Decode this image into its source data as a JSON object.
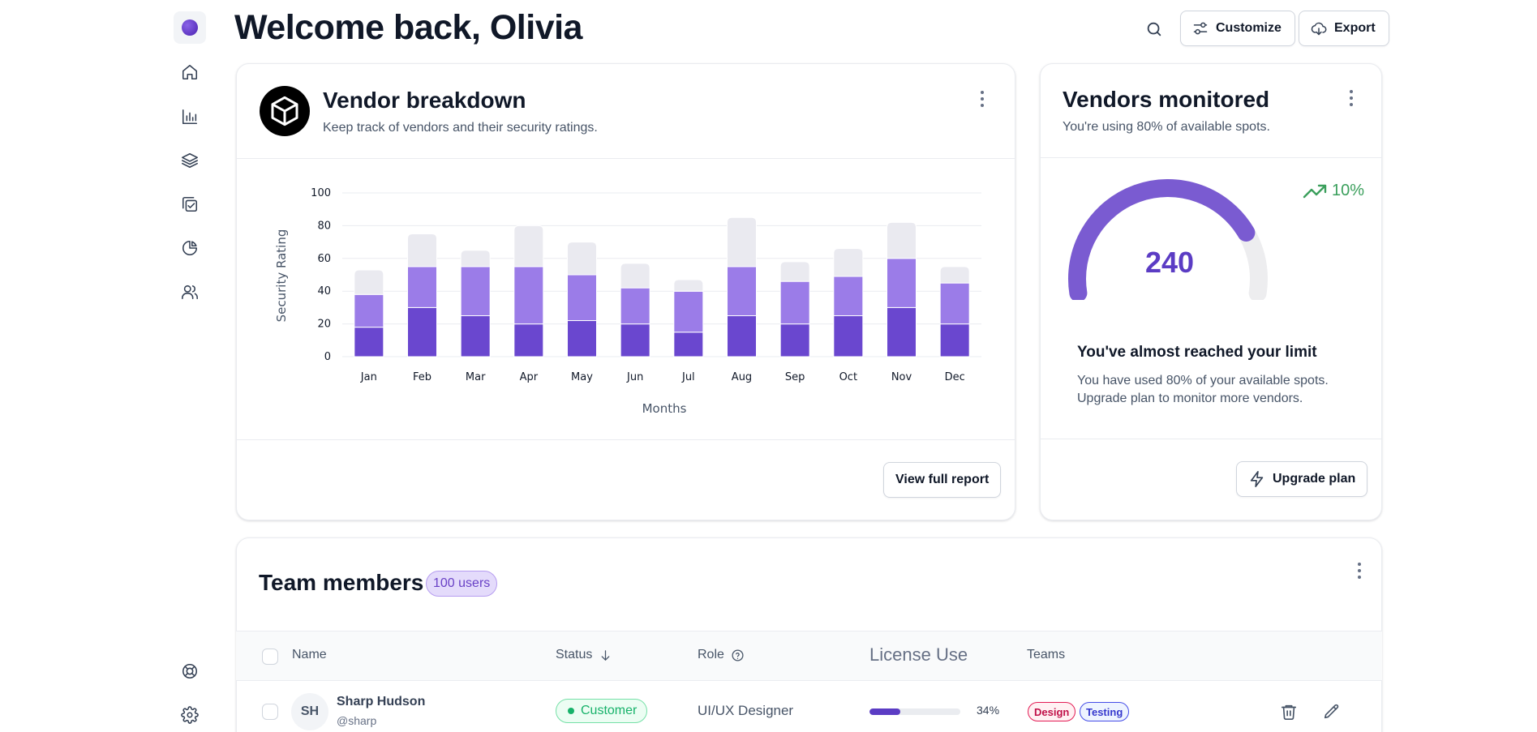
{
  "header": {
    "title": "Welcome back, Olivia",
    "customize_label": "Customize",
    "export_label": "Export"
  },
  "sidebar": {
    "items": [
      {
        "icon": "home-icon"
      },
      {
        "icon": "bar-chart-icon"
      },
      {
        "icon": "layers-icon"
      },
      {
        "icon": "check-square-icon"
      },
      {
        "icon": "pie-chart-icon"
      },
      {
        "icon": "users-icon"
      }
    ],
    "footer": [
      {
        "icon": "support-icon"
      },
      {
        "icon": "settings-icon"
      }
    ]
  },
  "vendor_breakdown": {
    "title": "Vendor breakdown",
    "subtitle": "Keep track of vendors and their security ratings.",
    "button_label": "View full report"
  },
  "chart_data": {
    "type": "bar",
    "stacked": true,
    "categories": [
      "Jan",
      "Feb",
      "Mar",
      "Apr",
      "May",
      "Jun",
      "Jul",
      "Aug",
      "Sep",
      "Oct",
      "Nov",
      "Dec"
    ],
    "series": [
      {
        "color": "#6a47cf",
        "values": [
          18,
          30,
          25,
          20,
          22,
          20,
          15,
          25,
          20,
          25,
          30,
          20
        ]
      },
      {
        "color": "#9b7ce8",
        "values": [
          20,
          25,
          30,
          35,
          28,
          22,
          25,
          30,
          26,
          24,
          30,
          25
        ]
      },
      {
        "color": "#eaeaf0",
        "values": [
          15,
          20,
          10,
          25,
          20,
          15,
          7,
          30,
          12,
          17,
          22,
          10
        ]
      }
    ],
    "xlabel": "Months",
    "ylabel": "Security Rating",
    "yticks": [
      0,
      20,
      40,
      60,
      80,
      100
    ],
    "ylim": [
      0,
      100
    ],
    "grid": true
  },
  "vendors_monitored": {
    "title": "Vendors monitored",
    "subtitle": "You're using 80% of available spots.",
    "trend": "10%",
    "gauge_value": "240",
    "gauge_fraction": 0.8,
    "limit_title": "You've almost reached your limit",
    "limit_text": "You have used 80% of your available spots. Upgrade plan to monitor more vendors.",
    "button_label": "Upgrade plan",
    "colors": {
      "gauge": "#7a5bd1",
      "track": "#ededef",
      "trend": "#3b9f5c"
    }
  },
  "team_members": {
    "title": "Team members",
    "badge": "100 users",
    "columns": [
      "Name",
      "Status",
      "Role",
      "License Use",
      "Teams"
    ],
    "rows": [
      {
        "initials": "SH",
        "name": "Sharp Hudson",
        "handle": "@sharp",
        "status": "Customer",
        "role": "UI/UX Designer",
        "license_percent": 34,
        "license_label": "34%",
        "teams": [
          "Design",
          "Testing"
        ]
      }
    ]
  }
}
